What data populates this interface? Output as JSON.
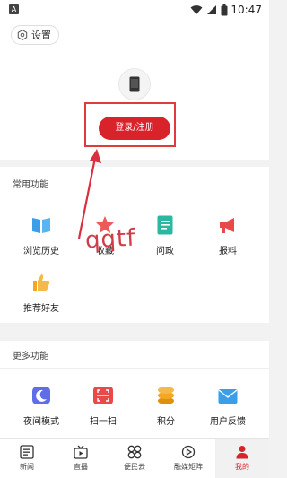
{
  "status_bar": {
    "time": "10:47",
    "indicator": "A"
  },
  "header": {
    "settings_label": "设置",
    "login_label": "登录/注册"
  },
  "common_functions": {
    "title": "常用功能",
    "items": [
      {
        "label": "浏览历史",
        "icon": "book-icon",
        "color": "#3a9ee8"
      },
      {
        "label": "收藏",
        "icon": "star-icon",
        "color": "#ee5a5a"
      },
      {
        "label": "问政",
        "icon": "document-icon",
        "color": "#2bb8a0"
      },
      {
        "label": "报料",
        "icon": "megaphone-icon",
        "color": "#e84a4a"
      },
      {
        "label": "推荐好友",
        "icon": "thumbs-up-icon",
        "color": "#f5a623"
      }
    ]
  },
  "more_functions": {
    "title": "更多功能",
    "items": [
      {
        "label": "夜间模式",
        "icon": "moon-icon",
        "color": "#5e6ee8"
      },
      {
        "label": "扫一扫",
        "icon": "scan-icon",
        "color": "#e84a4a"
      },
      {
        "label": "积分",
        "icon": "coins-icon",
        "color": "#f5a623"
      },
      {
        "label": "用户反馈",
        "icon": "mail-icon",
        "color": "#3a9ee8"
      }
    ]
  },
  "annotation": {
    "text": "qqtf",
    "color": "#d03c4a"
  },
  "bottom_nav": {
    "items": [
      {
        "label": "新闻",
        "icon": "newspaper-icon"
      },
      {
        "label": "直播",
        "icon": "tv-icon"
      },
      {
        "label": "便民云",
        "icon": "cloud-grid-icon"
      },
      {
        "label": "融媒矩阵",
        "icon": "media-matrix-icon"
      },
      {
        "label": "我的",
        "icon": "person-icon",
        "active": true
      }
    ]
  },
  "colors": {
    "accent": "#d8232a",
    "background": "#f2f2f2"
  }
}
